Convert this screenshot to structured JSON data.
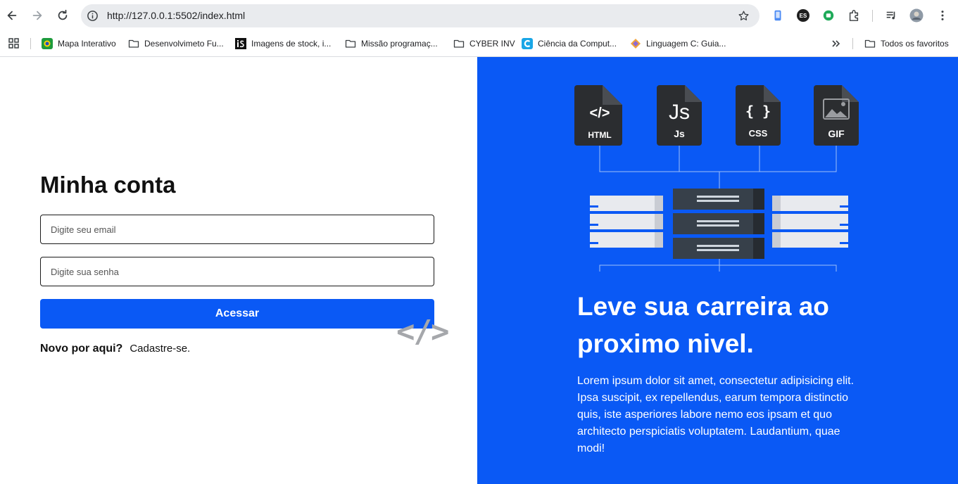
{
  "browser": {
    "url": "http://127.0.0.1:5502/index.html",
    "extension_es_label": "ES",
    "bookmarks": [
      {
        "label": "Mapa Interativo",
        "icon": "globe-icon"
      },
      {
        "label": "Desenvolvimeto Fu...",
        "icon": "folder-icon"
      },
      {
        "label": "Imagens de stock, i...",
        "icon": "istock-icon"
      },
      {
        "label": "Missão programaç...",
        "icon": "folder-icon"
      },
      {
        "label": "CYBER INV",
        "icon": "folder-icon"
      },
      {
        "label": "Ciência da Comput...",
        "icon": "c-logo-icon"
      },
      {
        "label": "Linguagem C: Guia...",
        "icon": "diamond-icon"
      }
    ],
    "all_bookmarks_label": "Todos os favoritos"
  },
  "login": {
    "title": "Minha conta",
    "email_placeholder": "Digite seu email",
    "password_placeholder": "Digite sua senha",
    "submit_label": "Acessar",
    "new_here": "Novo por aqui?",
    "signup_label": "Cadastre-se.",
    "decoration": "</>"
  },
  "hero": {
    "title": "Leve sua carreira ao proximo nivel.",
    "text": "Lorem ipsum dolor sit amet, consectetur adipisicing elit. Ipsa suscipit, ex repellendus, earum tempora distinctio quis, iste asperiores labore nemo eos ipsam et quo architecto perspiciatis voluptatem. Laudantium, quae modi!",
    "files": [
      {
        "glyph": "</>",
        "label": "HTML"
      },
      {
        "glyph": "Js",
        "label": "Js"
      },
      {
        "glyph": "{ }",
        "label": "CSS"
      },
      {
        "glyph": "",
        "label": "GIF"
      }
    ]
  },
  "colors": {
    "accent": "#0a59f5",
    "file_icon": "#2b2d30",
    "server_dark": "#37404a",
    "server_light": "#e8eaee"
  }
}
